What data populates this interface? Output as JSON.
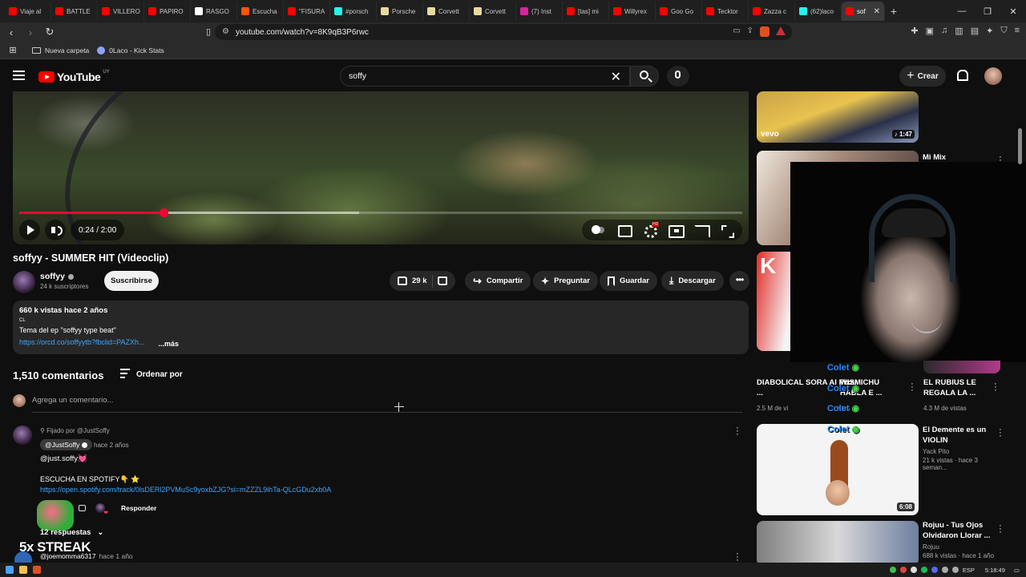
{
  "browser": {
    "tabs": [
      {
        "label": "Viaje al",
        "color": "#ff0000"
      },
      {
        "label": "BATTLE",
        "color": "#ff0000"
      },
      {
        "label": "VILLERO",
        "color": "#ff0000"
      },
      {
        "label": "PAPIRO",
        "color": "#ff0000"
      },
      {
        "label": "RASGO",
        "color": "#ffffff"
      },
      {
        "label": "Escucha",
        "color": "#ff5500"
      },
      {
        "label": "\"FISURA",
        "color": "#ff0000"
      },
      {
        "label": "#porsch",
        "color": "#25f4ee"
      },
      {
        "label": "Porsche",
        "color": "#e8d9a0"
      },
      {
        "label": "Corvett",
        "color": "#e8d9a0"
      },
      {
        "label": "Corvett",
        "color": "#e8d9a0"
      },
      {
        "label": "(7) Inst",
        "color": "#d6249f"
      },
      {
        "label": "[tas] mi",
        "color": "#ff0000"
      },
      {
        "label": "Willyrex",
        "color": "#ff0000"
      },
      {
        "label": "Goo Go",
        "color": "#ff0000"
      },
      {
        "label": "Tecktor",
        "color": "#ff0000"
      },
      {
        "label": "Zazza c",
        "color": "#ff0000"
      },
      {
        "label": "(62)laco",
        "color": "#25f4ee"
      },
      {
        "label": "sof",
        "color": "#ff0000",
        "active": true
      }
    ],
    "url": "youtube.com/watch?v=8K9qB3P6rwc",
    "bookmarks": [
      "Nueva carpeta",
      "0Laco - Kick Stats"
    ]
  },
  "header": {
    "logo_text": "YouTube",
    "country_code": "UY",
    "search_value": "soffy",
    "create_label": "Crear"
  },
  "player": {
    "time": "0:24 / 2:00",
    "progress_fraction": 0.2,
    "buffer_fraction": 0.47
  },
  "video": {
    "title": "soffyy - SUMMER HIT (Videoclip)",
    "channel": "soffyy",
    "subscribers": "24 k suscriptores",
    "subscribe_label": "Suscribirse",
    "likes": "29 k",
    "share_label": "Compartir",
    "ask_label": "Preguntar",
    "save_label": "Guardar",
    "download_label": "Descargar"
  },
  "description": {
    "meta": "660 k vistas  hace 2 años",
    "cl": "CL",
    "line": "Tema del ep \"soffyy type beat\"",
    "link": "https://orcd.co/soffyytb?fbclid=PAZXh...",
    "more": "...más"
  },
  "comments": {
    "count": "1,510 comentarios",
    "sort_label": "Ordenar por",
    "add_placeholder": "Agrega un comentario...",
    "pinned_label": "Fijado por @JustSoffy",
    "first": {
      "author": "@JustSoffy",
      "time": "hace 2 años",
      "line1": "@just.soffy💓",
      "line2": "ESCUCHA EN SPOTIFY👇 ⭐",
      "link": "https://open.spotify.com/track/0lsDERl2PVMuSc9yoxbZJG?si=mZZZL9ihTa-QLcGDu2xb0A",
      "reply_label": "Responder",
      "replies_label": "12 respuestas"
    },
    "second": {
      "author": "@joemomma6317",
      "time": "hace 1 año"
    }
  },
  "overlays": {
    "streak": "5x STREAK",
    "colet": "Colet"
  },
  "sidebar": {
    "videos": [
      {
        "title": "",
        "channel": "",
        "views": "",
        "duration": "1:47",
        "badge": "vevo"
      },
      {
        "title": "Mi Mix",
        "channel": "",
        "views": "",
        "duration": ""
      },
      {
        "title": "DIABOLICAL SORA AI Pixar ...",
        "channel": "",
        "views": "2.5 M de vi",
        "views2": "vistas"
      },
      {
        "title": "WISMICHU HABLA E ...",
        "channel": "",
        "views": ""
      },
      {
        "title": "EL RUBIUS LE REGALA LA ...",
        "channel": "",
        "views": "4.3 M de vistas"
      },
      {
        "title": "El Demente es un VIOLIN",
        "channel": "Yack Pito",
        "views": "21 k vistas · hace 3 seman...",
        "duration": "6:08"
      },
      {
        "title": "Rojuu - Tus Ojos Olvidaron Llorar ...",
        "channel": "Rojuu",
        "views": "688 k vistas · hace 1 año"
      }
    ]
  },
  "taskbar": {
    "lang": "ESP",
    "time": "5:18:49"
  }
}
